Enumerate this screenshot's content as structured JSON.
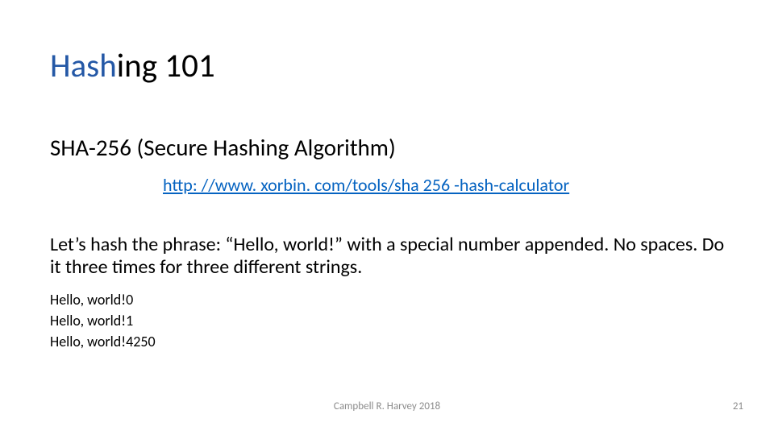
{
  "title": {
    "accent": "Hash",
    "rest": "ing 101"
  },
  "subtitle": "SHA-256 (Secure Hashing Algorithm)",
  "link": {
    "text": "http: //www. xorbin. com/tools/sha 256 -hash-calculator",
    "href": "http://www.xorbin.com/tools/sha256-hash-calculator"
  },
  "body": "Let’s hash the phrase: “Hello, world!” with a special number appended. No spaces. Do it three times for three different strings.",
  "examples": [
    "Hello, world!0",
    "Hello, world!1",
    "Hello, world!4250"
  ],
  "footer": {
    "center": "Campbell R. Harvey 2018",
    "page": "21"
  }
}
